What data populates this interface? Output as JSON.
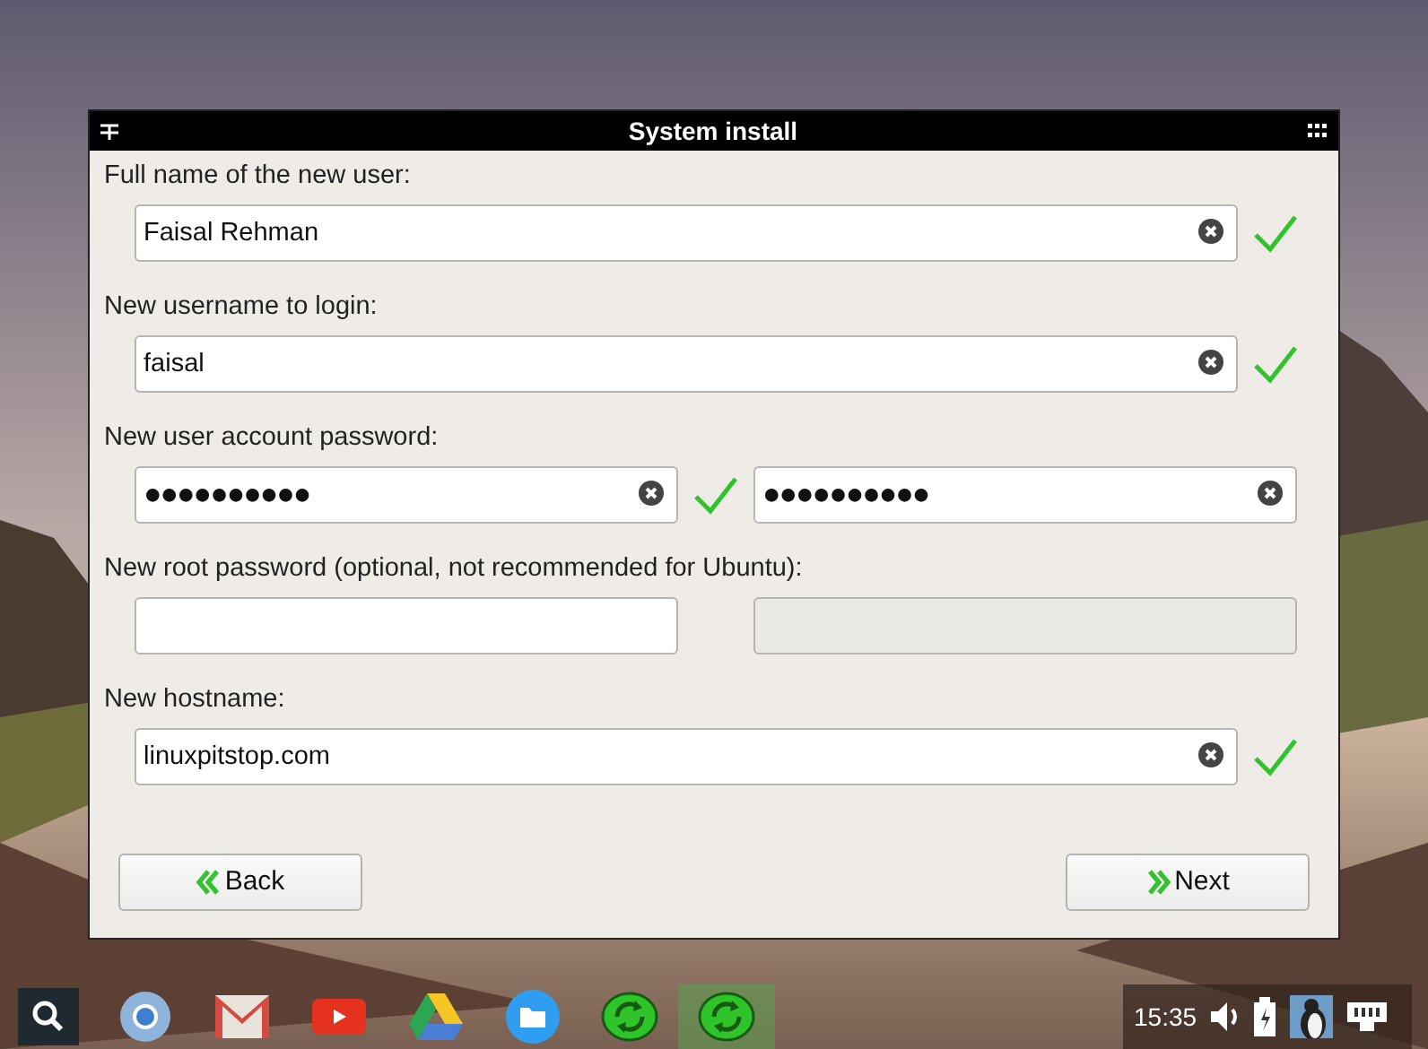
{
  "window": {
    "title": "System install"
  },
  "rows": [
    {
      "label": "Full name of the new user:",
      "inputs": [
        {
          "value": "Faisal Rehman",
          "clearable": true,
          "disabled": false,
          "valid": true
        }
      ]
    },
    {
      "label": "New username to login:",
      "inputs": [
        {
          "value": "faisal",
          "clearable": true,
          "disabled": false,
          "valid": true
        }
      ]
    },
    {
      "label": "New user account password:",
      "inputs": [
        {
          "value": "●●●●●●●●●●",
          "clearable": true,
          "disabled": false,
          "valid": true
        },
        {
          "value": "●●●●●●●●●●",
          "clearable": true,
          "disabled": false,
          "valid": false
        }
      ]
    },
    {
      "label": "New root password (optional, not recommended for Ubuntu):",
      "inputs": [
        {
          "clearable": false,
          "disabled": false,
          "valid": false
        },
        {
          "clearable": false,
          "disabled": true,
          "valid": false
        }
      ]
    },
    {
      "label": "New hostname:",
      "inputs": [
        {
          "value": "linuxpitstop.com",
          "clearable": true,
          "disabled": false,
          "valid": true
        }
      ]
    }
  ],
  "buttons": [
    {
      "label": "Back",
      "kind": "back"
    },
    {
      "label": "Next",
      "kind": "next"
    }
  ],
  "taskbar": {
    "apps": [
      {
        "kind": "search",
        "selected": false
      },
      {
        "kind": "chrome",
        "selected": false
      },
      {
        "kind": "mail",
        "selected": false
      },
      {
        "kind": "video",
        "selected": false
      },
      {
        "kind": "drive",
        "selected": false
      },
      {
        "kind": "files",
        "selected": false
      },
      {
        "kind": "sync",
        "selected": false
      },
      {
        "kind": "sync",
        "selected": true
      }
    ],
    "tray": {
      "time": "15:35"
    }
  }
}
